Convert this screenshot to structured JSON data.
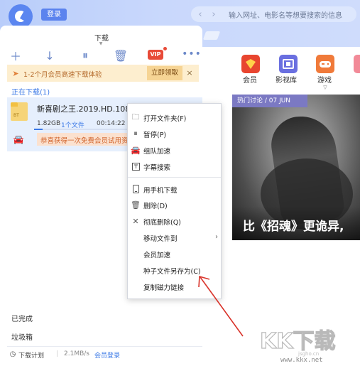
{
  "header": {
    "login_label": "登录",
    "url_placeholder": "输入网址、电影名等想要搜索的信息",
    "download_tab_label": "下载"
  },
  "toolbar": {
    "vip_badge": "VIP"
  },
  "promo": {
    "text": "1-2个月会员高速下载体验",
    "button_label": "立即领取",
    "close_label": "×"
  },
  "downloading": {
    "label": "正在下载(1)",
    "file": {
      "name": "新喜剧之王.2019.HD.1080p",
      "icon_text": "BT",
      "size": "1.82GB",
      "count": "1个文件",
      "time": "00:14:22",
      "progress": 0.09
    },
    "trial_text": "恭喜获得一次免费会员试用资"
  },
  "sidebar_bottom": {
    "completed_label": "已完成",
    "trash_label": "垃圾箱"
  },
  "status_bar": {
    "plan_label": "下载计划",
    "separator": "|",
    "speed": "2.1MB/s",
    "vip_login": "会员登录"
  },
  "categories": [
    {
      "label": "会员",
      "color": "#e8452f"
    },
    {
      "label": "影视库",
      "color": "#6a6fe0"
    },
    {
      "label": "游戏",
      "color": "#f07a3a"
    }
  ],
  "hero": {
    "tag": "热门讨论 / 07 JUN",
    "title": "比《招魂》更诡异,"
  },
  "context_menu": {
    "items": [
      {
        "label": "打开文件夹(F)",
        "icon": "folder-icon"
      },
      {
        "label": "暂停(P)",
        "icon": "pause-icon"
      },
      {
        "label": "组队加速",
        "icon": "car-icon"
      },
      {
        "label": "字幕搜索",
        "icon": "subtitle-icon"
      },
      {
        "label": "用手机下载",
        "icon": "phone-icon"
      },
      {
        "label": "删除(D)",
        "icon": "trash-icon"
      },
      {
        "label": "彻底删除(Q)",
        "icon": "close-icon"
      },
      {
        "label": "移动文件到",
        "icon": ""
      },
      {
        "label": "会员加速",
        "icon": ""
      },
      {
        "label": "种子文件另存为(C)",
        "icon": ""
      },
      {
        "label": "复制磁力链接",
        "icon": ""
      }
    ]
  },
  "watermark": {
    "brand": "KK下载",
    "url": "www.kkx.net"
  },
  "colors": {
    "accent": "#3a78e6",
    "vip": "#e84a38",
    "header": "#c9d8fc",
    "annotation": "#d9342b"
  }
}
